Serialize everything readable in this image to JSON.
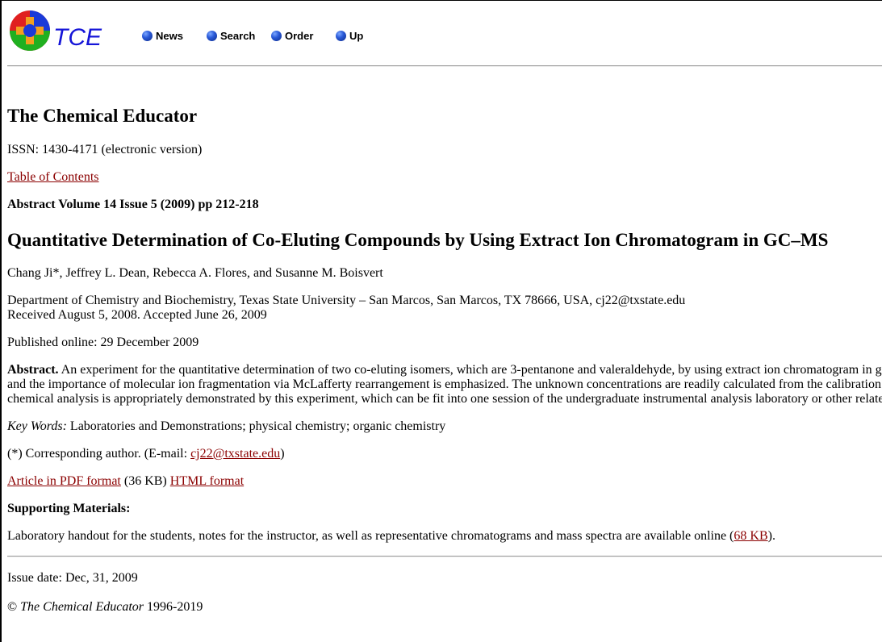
{
  "header": {
    "logo_text": "TCE",
    "nav": [
      {
        "label": "News"
      },
      {
        "label": "Search"
      },
      {
        "label": "Order"
      },
      {
        "label": "Up"
      }
    ]
  },
  "journal_title": "The Chemical Educator",
  "issn": "ISSN: 1430-4171 (electronic version)",
  "toc_link": "Table of Contents",
  "abstract_ref": "Abstract Volume 14 Issue 5 (2009) pp 212-218",
  "article_title": "Quantitative Determination of Co-Eluting Compounds by Using Extract Ion Chromatogram in GC–MS",
  "authors": "Chang Ji*, Jeffrey L. Dean, Rebecca A. Flores, and Susanne M. Boisvert",
  "affiliation": "Department of Chemistry and Biochemistry, Texas State University – San Marcos, San Marcos, TX 78666, USA, cj22@txstate.edu",
  "received": "Received August 5, 2008. Accepted June 26, 2009",
  "published": "Published online: 29 December 2009",
  "abstract": {
    "label": "Abstract.",
    "line1": " An experiment for the quantitative determination of two co-eluting isomers, which are 3-pentanone and valeraldehyde, by using extract ion chromatogram in g",
    "line2": "and the importance of molecular ion fragmentation via McLafferty rearrangement is emphasized. The unknown concentrations are readily calculated from the calibration",
    "line3": "chemical analysis is appropriately demonstrated by this experiment, which can be fit into one session of the undergraduate instrumental analysis laboratory or other relate"
  },
  "keywords": {
    "label": "Key Words:",
    "text": " Laboratories and Demonstrations; physical chemistry; organic chemistry"
  },
  "corresponding": {
    "prefix": "(*) Corresponding author. (E-mail: ",
    "email": "cj22@txstate.edu",
    "suffix": ")"
  },
  "downloads": {
    "pdf_link": "Article in PDF format",
    "pdf_size": " (36 KB) ",
    "html_link": "HTML format"
  },
  "supporting_heading": "Supporting Materials:",
  "supporting": {
    "text": "Laboratory handout for the students, notes for the instructor, as well as representative chromatograms and mass spectra are available online (",
    "link": "68 KB",
    "suffix": ")."
  },
  "issue_date": "Issue date: Dec, 31, 2009",
  "copyright": {
    "symbol": "© ",
    "name": "The Chemical Educator",
    "years": " 1996-2019"
  }
}
